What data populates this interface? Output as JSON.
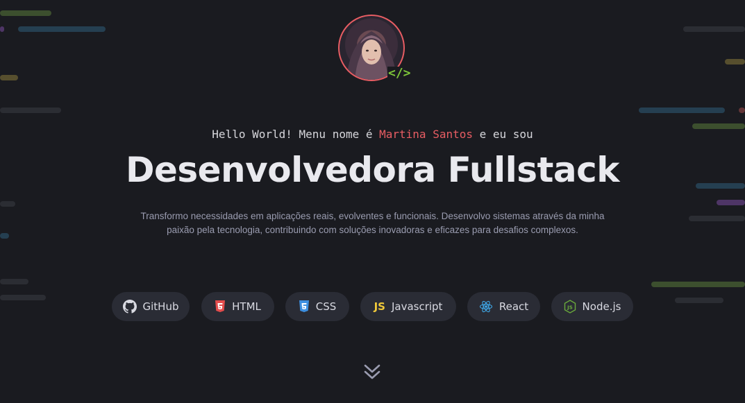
{
  "profile": {
    "avatar_icon": "avatar-photo",
    "badge_text": "</>"
  },
  "intro": {
    "hello_prefix": "Hello World! Menu nome é ",
    "name": "Martina Santos",
    "hello_suffix": " e eu sou"
  },
  "title": "Desenvolvedora Fullstack",
  "description": {
    "line1": "Transformo necessidades em aplicações reais, evolventes e funcionais. Desenvolvo sistemas através da minha",
    "line2": "paixão pela tecnologia, contribuindo com soluções inovadoras e eficazes para desafios complexos."
  },
  "techs": [
    {
      "label": "GitHub",
      "icon": "github-icon",
      "color": "#d9dae2"
    },
    {
      "label": "HTML",
      "icon": "html5-icon",
      "color": "#e44d4d"
    },
    {
      "label": "CSS",
      "icon": "css3-icon",
      "color": "#3d8fe0"
    },
    {
      "label": "Javascript",
      "icon": "js-icon",
      "color": "#f0c93a"
    },
    {
      "label": "React",
      "icon": "react-icon",
      "color": "#3fa8e8"
    },
    {
      "label": "Node.js",
      "icon": "nodejs-icon",
      "color": "#6aaa3b"
    }
  ],
  "scroll": {
    "icon": "chevrons-down-icon"
  },
  "colors": {
    "background": "#1a1b20",
    "accent": "#e85d63",
    "chip_bg": "#2a2c35"
  }
}
